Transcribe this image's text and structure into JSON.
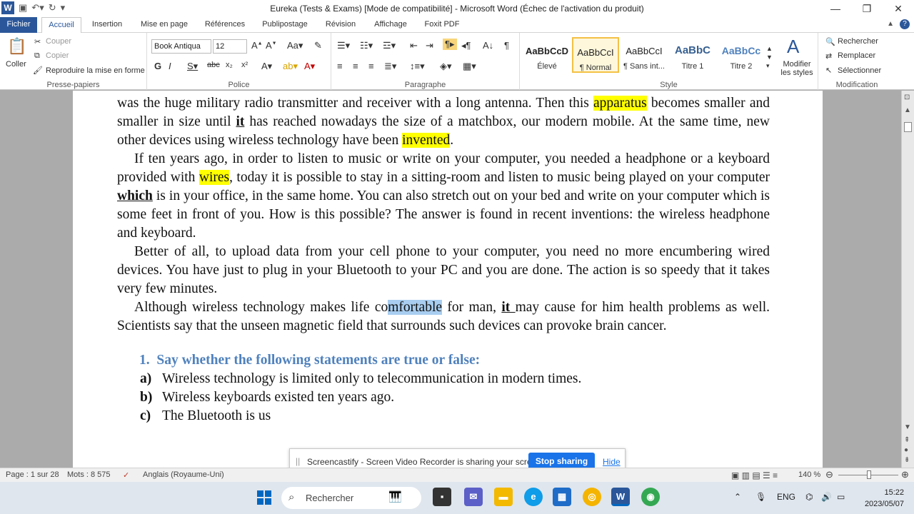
{
  "window": {
    "title": "Eureka (Tests & Exams) [Mode de compatibilité] - Microsoft Word (Échec de l'activation du produit)"
  },
  "tabs": [
    "Fichier",
    "Accueil",
    "Insertion",
    "Mise en page",
    "Références",
    "Publipostage",
    "Révision",
    "Affichage",
    "Foxit PDF"
  ],
  "ribbon": {
    "clipboard": {
      "paste": "Coller",
      "cut": "Couper",
      "copy": "Copier",
      "format_painter": "Reproduire la mise en forme",
      "group": "Presse-papiers"
    },
    "font": {
      "name": "Book Antiqua",
      "size": "12",
      "group": "Police"
    },
    "paragraph": {
      "group": "Paragraphe"
    },
    "styles": {
      "group": "Style",
      "items": [
        {
          "preview": "AaBbCcD",
          "name": "Élevé"
        },
        {
          "preview": "AaBbCcI",
          "name": "¶ Normal"
        },
        {
          "preview": "AaBbCcI",
          "name": "¶ Sans int..."
        },
        {
          "preview": "AaBbC",
          "name": "Titre 1"
        },
        {
          "preview": "AaBbCc",
          "name": "Titre 2"
        }
      ],
      "change": "Modifier les styles"
    },
    "editing": {
      "group": "Modification",
      "find": "Rechercher",
      "replace": "Remplacer",
      "select": "Sélectionner"
    }
  },
  "document": {
    "p1": {
      "a": "was the huge military radio transmitter and receiver with a long antenna. Then this ",
      "b": "apparatus",
      "c": " becomes smaller and smaller in size until ",
      "d": "it",
      "e": " has reached nowadays the size of          a matchbox, our modern mobile. At the same time, new other devices using wireless technology have been ",
      "f": "invented",
      "g": "."
    },
    "p2": {
      "a": "If ten years ago, in order to listen to music or write on your computer, you needed                a headphone or a keyboard provided with ",
      "b": "wires",
      "c": ", today it is possible to stay in a sitting-room and listen to music being played on your computer ",
      "d": "which",
      "e": " is in your office, in the same home. You can also stretch out on your bed and write on your computer which is some feet in front of you. How is this possible? The answer is found in recent inventions: the wireless headphone and keyboard."
    },
    "p3": "Better of all, to upload data from your cell phone to your computer, you need no more encumbering wired devices. You have just to plug in your Bluetooth to your PC and you are done. The action is so speedy that it takes very few minutes.",
    "p4": {
      "a": "Although wireless technology makes life co",
      "b": "mfortable",
      "c": " for man, ",
      "d": "it ",
      "e": "may cause for him health problems as well. Scientists say that the unseen magnetic field that surrounds such devices can provoke brain cancer."
    },
    "question": {
      "num": "1.",
      "text": "Say whether the following statements are true or false:"
    },
    "items": [
      {
        "label": "a)",
        "text": "Wireless technology is limited only to telecommunication in modern times."
      },
      {
        "label": "b)",
        "text": "Wireless keyboards existed ten years ago."
      },
      {
        "label": "c)",
        "text": "The Bluetooth is us"
      }
    ]
  },
  "status": {
    "page": "Page : 1 sur 28",
    "words": "Mots : 8 575",
    "language": "Anglais (Royaume-Uni)",
    "zoom": "140 %"
  },
  "screencastify": {
    "message": "Screencastify - Screen Video Recorder is sharing your screen.",
    "stop": "Stop sharing",
    "hide": "Hide"
  },
  "taskbar": {
    "search": "Rechercher",
    "lang": "ENG",
    "time": "15:22",
    "date": "2023/05/07"
  }
}
